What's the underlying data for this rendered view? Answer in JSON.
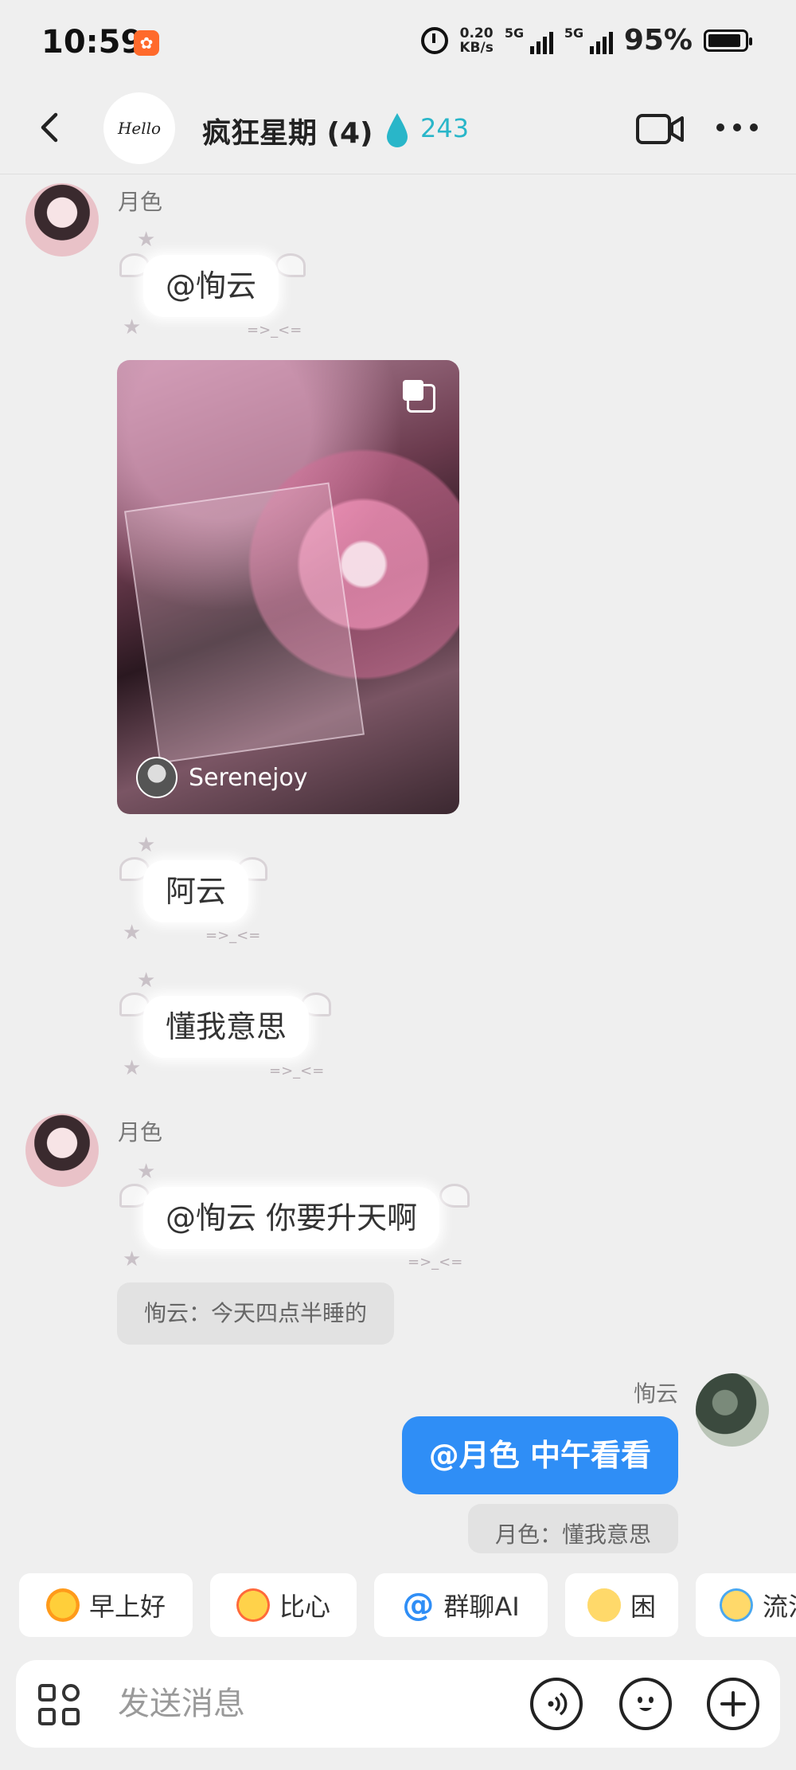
{
  "status_bar": {
    "time": "10:59",
    "speed_value": "0.20",
    "speed_unit": "KB/s",
    "sim1": "5G",
    "sim2": "5G",
    "battery_pct": "95%"
  },
  "header": {
    "group_avatar_text": "Hello",
    "title": "疯狂星期 (4)",
    "spark_count": "243",
    "drop_color": "#29b6c9"
  },
  "messages": {
    "sender1": "月色",
    "msg1": "@恂云",
    "image_author": "Serenejoy",
    "msg2": "阿云",
    "msg3": "懂我意思",
    "sender2": "月色",
    "msg4": "@恂云 你要升天啊",
    "quote1": "恂云：今天四点半睡的",
    "sender3": "恂云",
    "msg5": "@月色 中午看看",
    "quote2": "月色：懂我意思",
    "deco_text": "=>_<="
  },
  "quick_replies": [
    {
      "label": "早上好",
      "icon": "sun-face-emoji"
    },
    {
      "label": "比心",
      "icon": "heart-hand-emoji"
    },
    {
      "label": "群聊AI",
      "icon": "at-icon"
    },
    {
      "label": "困",
      "icon": "sleepy-face-emoji"
    },
    {
      "label": "流泪",
      "icon": "crying-face-emoji"
    }
  ],
  "input": {
    "placeholder": "发送消息"
  },
  "colors": {
    "accent": "#2f8ef6",
    "background": "#efefef"
  }
}
